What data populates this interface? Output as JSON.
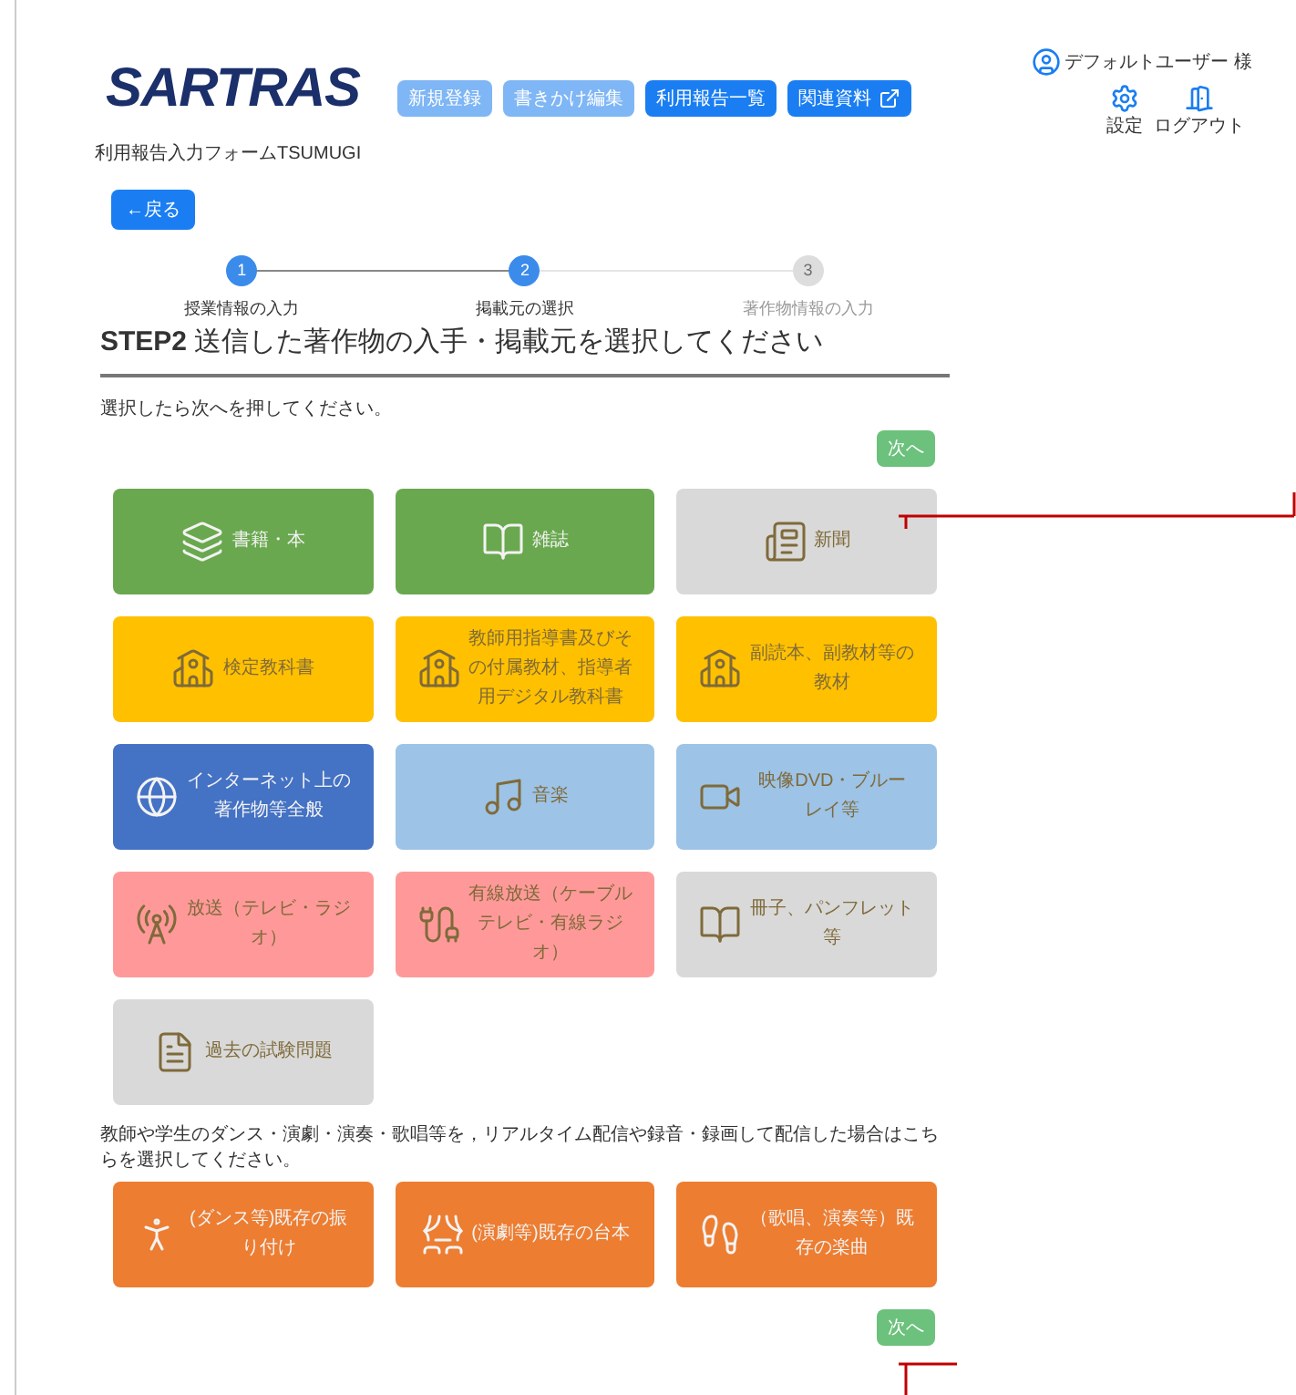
{
  "header": {
    "logo": "SARTRAS",
    "subtitle": "利用報告入力フォームTSUMUGI",
    "nav": [
      {
        "label": "新規登録",
        "disabled": true,
        "external": false
      },
      {
        "label": "書きかけ編集",
        "disabled": true,
        "external": false
      },
      {
        "label": "利用報告一覧",
        "disabled": false,
        "external": false
      },
      {
        "label": "関連資料",
        "disabled": false,
        "external": true
      }
    ],
    "user": "デフォルトユーザー 様",
    "settings": "設定",
    "logout": "ログアウト"
  },
  "back": "←戻る",
  "steps": [
    {
      "number": "1",
      "label": "授業情報の入力",
      "reached": true
    },
    {
      "number": "2",
      "label": "掲載元の選択",
      "reached": true
    },
    {
      "number": "3",
      "label": "著作物情報の入力",
      "reached": false
    }
  ],
  "step_title": {
    "step": "STEP2",
    "text": "送信した著作物の入手・掲載元を選択してください"
  },
  "instruction": "選択したら次へを押してください。",
  "next_top": "次へ",
  "sources": [
    {
      "kind": "books",
      "label": "書籍・本",
      "color": "#6aa84f"
    },
    {
      "kind": "magazine",
      "label": "雑誌",
      "color": "#6aa84f"
    },
    {
      "kind": "newspaper",
      "label": "新聞",
      "color": "#d9d9d9"
    },
    {
      "kind": "school",
      "label": "検定教科書",
      "color": "#ffc000"
    },
    {
      "kind": "school",
      "label": "教師用指導書及びその付属教材、指導者用デジタル教科書",
      "color": "#ffc000"
    },
    {
      "kind": "school",
      "label": "副読本、副教材等の教材",
      "color": "#ffc000"
    },
    {
      "kind": "internet",
      "label": "インターネット上の著作物等全般",
      "color": "#4472c4"
    },
    {
      "kind": "music",
      "label": "音楽",
      "color": "#9dc3e6"
    },
    {
      "kind": "video",
      "label": "映像DVD・ブルーレイ等",
      "color": "#9dc3e6"
    },
    {
      "kind": "broadcast",
      "label": "放送（テレビ・ラジオ）",
      "color": "#ff9999"
    },
    {
      "kind": "cable",
      "label": "有線放送（ケーブルテレビ・有線ラジオ）",
      "color": "#ff9999"
    },
    {
      "kind": "magazine",
      "label": "冊子、パンフレット等",
      "color": "#d9d9d9"
    },
    {
      "kind": "exam",
      "label": "過去の試験問題",
      "color": "#d9d9d9"
    }
  ],
  "performance_note": "教師や学生のダンス・演劇・演奏・歌唱等を，リアルタイム配信や録音・録画して配信した場合はこちらを選択してください。",
  "performances": [
    {
      "kind": "dance",
      "label": "(ダンス等)既存の振り付け",
      "color": "#ed7d31"
    },
    {
      "kind": "stage",
      "label": "(演劇等)既存の台本",
      "color": "#ed7d31"
    },
    {
      "kind": "run",
      "label": "（歌唱、演奏等）既存の楽曲",
      "color": "#ed7d31"
    }
  ],
  "next_bottom": "次へ"
}
